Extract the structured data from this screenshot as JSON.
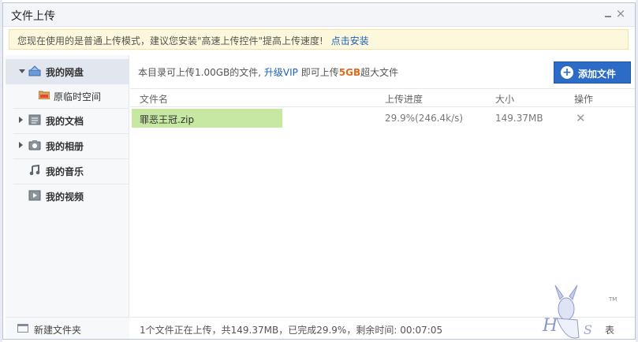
{
  "window": {
    "title": "文件上传"
  },
  "notice": {
    "text": "您现在使用的是普通上传模式，建议您安装\"高速上传控件\"提高上传速度!",
    "link": "点击安装"
  },
  "sidebar": {
    "items": [
      {
        "label": "我的网盘",
        "icon": "cloud-drive-icon",
        "expanded": true,
        "active": true
      },
      {
        "label": "我的文档",
        "icon": "document-icon",
        "expanded": false
      },
      {
        "label": "我的相册",
        "icon": "camera-icon",
        "expanded": false
      },
      {
        "label": "我的音乐",
        "icon": "music-note-icon",
        "expanded": false
      },
      {
        "label": "我的视频",
        "icon": "video-icon",
        "expanded": false
      }
    ],
    "sub_item": {
      "label": "原临时空间",
      "icon": "folder-icon"
    },
    "new_folder": "新建文件夹"
  },
  "main": {
    "info": {
      "prefix": "本目录可上传1.00GB的文件,",
      "vip": "升级VIP",
      "middle": "即可上传",
      "big": "5GB",
      "suffix": "超大文件"
    },
    "add_button": "添加文件",
    "columns": {
      "name": "文件名",
      "progress": "上传进度",
      "size": "大小",
      "op": "操作"
    },
    "files": [
      {
        "name": "罪恶王冠.zip",
        "progress": "29.9%(246.4k/s)",
        "size": "149.37MB",
        "fraction": 0.299
      }
    ],
    "status": "1个文件正在上传，共149.37MB，已完成29.9%，剩余时间: 00:07:05",
    "status_right": "表"
  },
  "colors": {
    "accent": "#2c6cc6",
    "progress": "#c7e8a3",
    "highlight": "#e26a1d",
    "link": "#1a62b8"
  }
}
